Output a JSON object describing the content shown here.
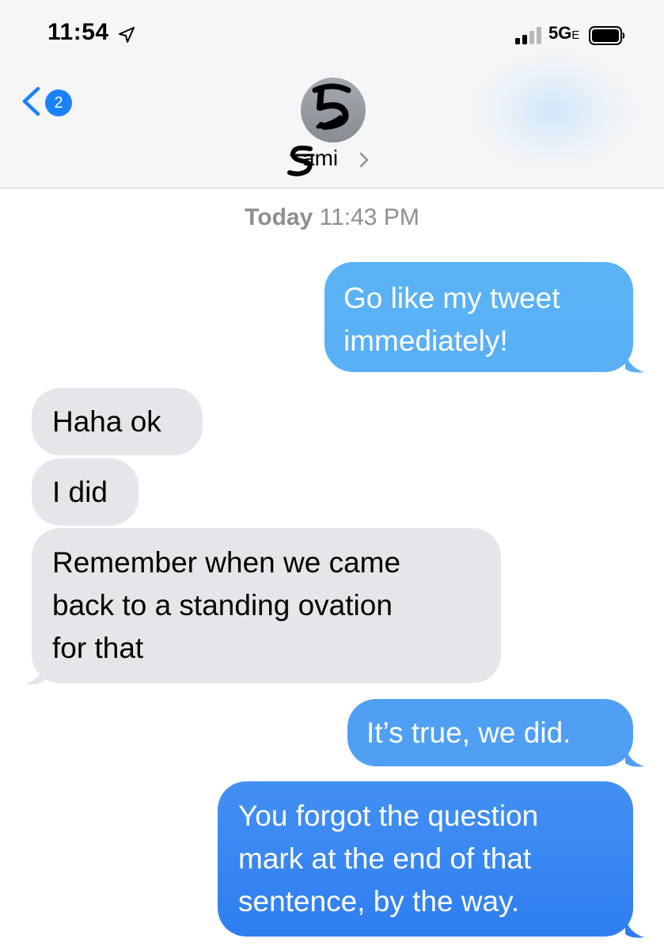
{
  "status_bar": {
    "time": "11:54",
    "network": "5G",
    "network_suffix": "E",
    "location_icon": "location-arrow-icon",
    "signal_icon": "cellular-signal-icon",
    "battery_icon": "battery-icon"
  },
  "nav": {
    "back_badge": "2",
    "back_icon": "chevron-left-icon",
    "contact_name": "ami",
    "contact_chevron_icon": "chevron-right-icon",
    "avatar_glyph": "5"
  },
  "thread": {
    "timestamp_day": "Today",
    "timestamp_time": "11:43 PM",
    "messages": [
      {
        "side": "outgoing",
        "text": "Go like my tweet\nimmediately!"
      },
      {
        "side": "incoming",
        "text": "Haha ok"
      },
      {
        "side": "incoming",
        "text": "I did"
      },
      {
        "side": "incoming",
        "text": "Remember when we came\nback to a standing ovation\nfor that"
      },
      {
        "side": "outgoing",
        "text": "It’s true, we did."
      },
      {
        "side": "outgoing",
        "text": "You forgot the question\nmark at the end of that\nsentence, by the way."
      }
    ]
  },
  "colors": {
    "outgoing_top": "#5ab3f5",
    "outgoing_bottom": "#2f7ef0",
    "incoming": "#e5e5ea",
    "badge": "#1a82fb",
    "timestamp": "#8e8e93"
  }
}
